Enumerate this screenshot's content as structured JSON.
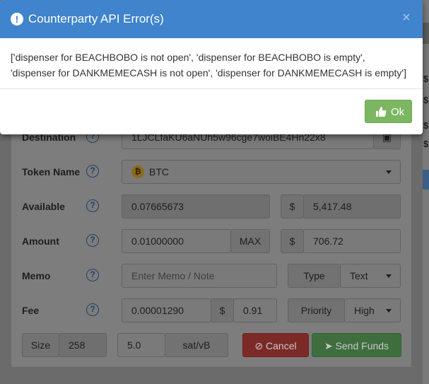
{
  "modal": {
    "title": "Counterparty API Error(s)",
    "close_label": "×",
    "message_line1": "['dispenser for BEACHBOBO is not open', 'dispenser for BEACHBOBO is empty',",
    "message_line2": "'dispenser for DANKMEMECASH is not open', 'dispenser for DANKMEMECASH is empty']",
    "ok_label": "Ok"
  },
  "form": {
    "destination": {
      "label": "Destination",
      "value": "1LJCLfaKU6aNUh5w96cge7woiBE4Hn22x8"
    },
    "token": {
      "label": "Token Name",
      "value": "BTC"
    },
    "available": {
      "label": "Available",
      "value": "0.07665673",
      "currency": "$",
      "usd": "5,417.48"
    },
    "amount": {
      "label": "Amount",
      "value": "0.01000000",
      "max_label": "MAX",
      "currency": "$",
      "usd": "706.72"
    },
    "memo": {
      "label": "Memo",
      "placeholder": "Enter Memo / Note",
      "type_label": "Type",
      "type_value": "Text"
    },
    "fee": {
      "label": "Fee",
      "value": "0.00001290",
      "currency": "$",
      "usd": "0.91",
      "priority_label": "Priority",
      "priority_value": "High"
    },
    "size": {
      "label": "Size",
      "value": "258"
    },
    "rate": {
      "value": "5.0",
      "unit": "sat/vB"
    },
    "cancel_label": "Cancel",
    "send_label": "Send Funds"
  },
  "side": {
    "marks": [
      "$",
      "$",
      "$",
      "$"
    ]
  },
  "colors": {
    "header": "#3f84cc",
    "ok": "#7bb661",
    "cancel": "#d9534f",
    "send": "#5cb85c"
  }
}
